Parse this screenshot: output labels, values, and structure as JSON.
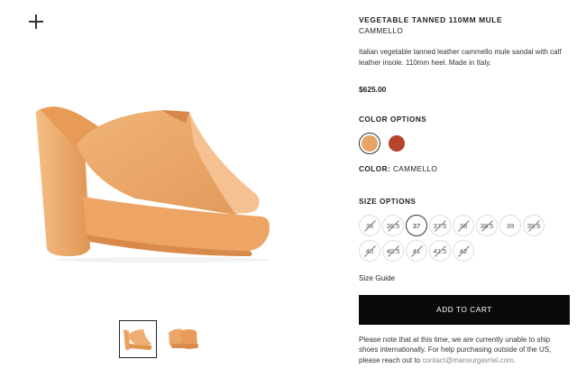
{
  "product": {
    "name": "VEGETABLE TANNED 110MM MULE",
    "color_name": "CAMMELLO",
    "description": "Italian vegetable tanned leather cammello mule sandal with calf leather insole. 110mm heel. Made in Italy.",
    "price": "$625.00",
    "main_image_icon": "mule-shoe-image"
  },
  "color_options": {
    "label": "COLOR OPTIONS",
    "swatches": [
      {
        "name": "cammello",
        "hex": "#e8a466",
        "selected": true
      },
      {
        "name": "rust",
        "hex": "#b5442a",
        "selected": false
      }
    ],
    "current_label": "COLOR:",
    "current_value": "CAMMELLO"
  },
  "size_options": {
    "label": "SIZE OPTIONS",
    "sizes": [
      {
        "label": "36",
        "available": false
      },
      {
        "label": "36.5",
        "available": false
      },
      {
        "label": "37",
        "available": true
      },
      {
        "label": "37.5",
        "available": false
      },
      {
        "label": "38",
        "available": false
      },
      {
        "label": "38.5",
        "available": false
      },
      {
        "label": "39",
        "available": false
      },
      {
        "label": "39.5",
        "available": false
      },
      {
        "label": "40",
        "available": false
      },
      {
        "label": "40.5",
        "available": false
      },
      {
        "label": "41",
        "available": false
      },
      {
        "label": "41.5",
        "available": false
      },
      {
        "label": "42",
        "available": false
      }
    ]
  },
  "size_guide_label": "Size Guide",
  "add_to_cart_label": "ADD TO CART",
  "shipping_note": "Please note that at this time, we are currently unable to ship shoes internationally. For help purchasing outside of the US, please reach out to",
  "contact_email": "contact@mansurgavriel.com.",
  "colors": {
    "accent": "#0a0a0a",
    "shoe": "#e8a466",
    "shoe_dark": "#d98a4a"
  }
}
